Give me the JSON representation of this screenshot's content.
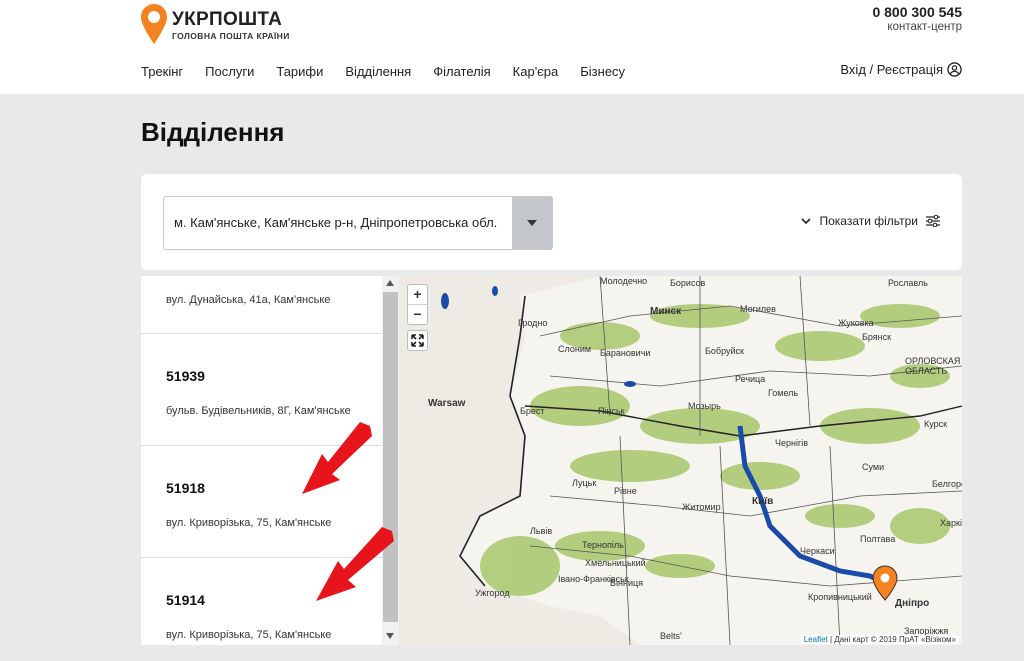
{
  "header": {
    "logo_name": "УКРПОШТА",
    "logo_tagline": "ГОЛОВНА ПОШТА КРАЇНИ",
    "phone": "0 800 300 545",
    "phone_caption": "контакт-центр",
    "nav": [
      "Трекінг",
      "Послуги",
      "Тарифи",
      "Відділення",
      "Філателія",
      "Кар'єра",
      "Бізнесу"
    ],
    "login_label": "Вхід / Реєстрація"
  },
  "page": {
    "title": "Відділення"
  },
  "search": {
    "selected_value": "м. Кам'янське, Кам'янське р-н, Дніпропетровська обл.",
    "filters_label": "Показати фільтри"
  },
  "offices": [
    {
      "code": "",
      "address": "вул. Дунайська, 41а, Кам'янське"
    },
    {
      "code": "51939",
      "address": "бульв. Будівельників, 8Г, Кам'янське"
    },
    {
      "code": "51918",
      "address": "вул. Криворізька, 75, Кам'янське"
    },
    {
      "code": "51914",
      "address": "вул. Криворізька, 75, Кам'янське"
    }
  ],
  "map": {
    "zoom_in": "+",
    "zoom_out": "−",
    "attribution_leaflet": "Leaflet",
    "attribution_text": " | Дані карт © 2019 ПрАТ «Візіком»",
    "cities": [
      {
        "name": "Минск",
        "big": true
      },
      {
        "name": "Warsaw",
        "big": true
      },
      {
        "name": "Київ",
        "big": true
      },
      {
        "name": "Дніпро",
        "big": true
      },
      {
        "name": "Гродно",
        "big": false
      },
      {
        "name": "Брест",
        "big": false
      },
      {
        "name": "Пінськ",
        "big": false
      },
      {
        "name": "Гомель",
        "big": false
      },
      {
        "name": "Могилев",
        "big": false
      },
      {
        "name": "Бобруйск",
        "big": false
      },
      {
        "name": "Барановичи",
        "big": false
      },
      {
        "name": "Слоним",
        "big": false
      },
      {
        "name": "Мозырь",
        "big": false
      },
      {
        "name": "Чернігів",
        "big": false
      },
      {
        "name": "Житомир",
        "big": false
      },
      {
        "name": "Луцьк",
        "big": false
      },
      {
        "name": "Рівне",
        "big": false
      },
      {
        "name": "Львів",
        "big": false
      },
      {
        "name": "Тернопіль",
        "big": false
      },
      {
        "name": "Ужгород",
        "big": false
      },
      {
        "name": "Івано-Франківськ",
        "big": false
      },
      {
        "name": "Черкаси",
        "big": false
      },
      {
        "name": "Кропивницький",
        "big": false
      },
      {
        "name": "Запоріжжя",
        "big": false
      },
      {
        "name": "Харків",
        "big": false
      },
      {
        "name": "Брянск",
        "big": false
      },
      {
        "name": "Жуковка",
        "big": false
      },
      {
        "name": "Борисов",
        "big": false
      },
      {
        "name": "Молодечно",
        "big": false
      },
      {
        "name": "ОРЛОВСКАЯ ОБЛАСТЬ",
        "big": false
      },
      {
        "name": "Курск",
        "big": false
      },
      {
        "name": "Белгород",
        "big": false
      },
      {
        "name": "Рославль",
        "big": false
      },
      {
        "name": "Речица",
        "big": false
      },
      {
        "name": "Вінниця",
        "big": false
      },
      {
        "name": "Хмельницький",
        "big": false
      },
      {
        "name": "Суми",
        "big": false
      },
      {
        "name": "Полтава",
        "big": false
      },
      {
        "name": "Belts'",
        "big": false
      }
    ]
  },
  "colors": {
    "brand_orange": "#f58220",
    "arrow_red": "#e8141c"
  }
}
